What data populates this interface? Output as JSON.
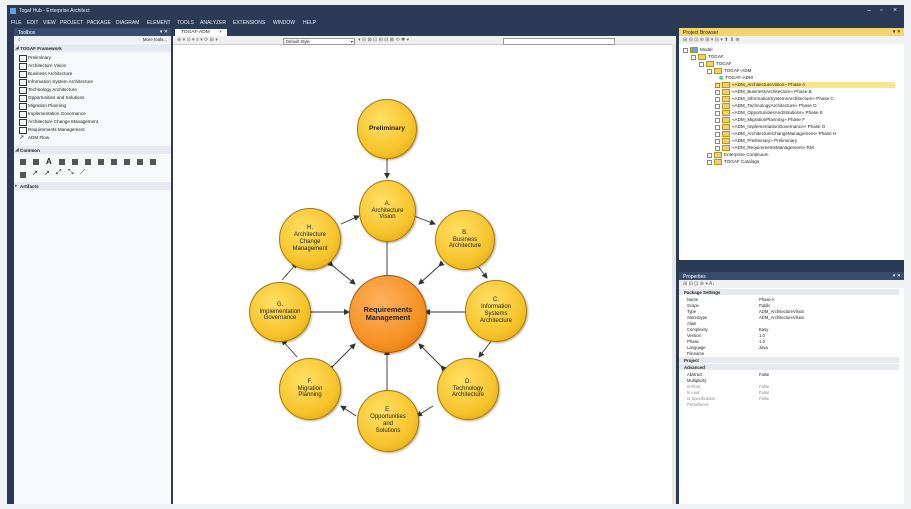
{
  "window": {
    "title": "Togaf Hub - Enterprise Architect"
  },
  "menu": [
    "FILE",
    "EDIT",
    "VIEW",
    "PROJECT",
    "PACKAGE",
    "DIAGRAM",
    "ELEMENT",
    "TOOLS",
    "ANALYZER",
    "EXTENSIONS",
    "WINDOW",
    "HELP"
  ],
  "toolbox": {
    "title": "Toolbox",
    "more_tools": "More tools...",
    "section_togaf": "TOGAF Framework",
    "items": [
      "Preliminary",
      "Architecture Vision",
      "Business Architecture",
      "Information System Architecture",
      "Technology Architecture",
      "Opportunities and Solutions",
      "Migration Planning",
      "Implementation Governance",
      "Architecture Change Management",
      "Requirements Management",
      "ADM Flow"
    ],
    "section_common": "Common",
    "section_artifacts": "Artifacts"
  },
  "diagram": {
    "tab": "TOGAF-ADM",
    "style": "Default Style",
    "nodes": {
      "prelim": "Preliminary",
      "a": "A.\nArchitecture\nVision",
      "b": "B.\nBusiness\nArchitecture",
      "c": "C.\nInformation\nSystems\nArchitecture",
      "d": "D.\nTechnology\nArchitecture",
      "e": "E.\nOpportunities\nand\nSolutions",
      "f": "F.\nMigration\nPlanning",
      "g": "G.\nImplementation\nGovernance",
      "h": "H.\nArchitecture\nChange\nManagement",
      "center": "Requirements\nManagement"
    }
  },
  "browser": {
    "title": "Project Browser",
    "model": "Model",
    "togaf": "TOGAF",
    "togaf2": "TOGAF",
    "adm": "TOGAF-ADM",
    "adm_diagram": "TOGAF-ADM",
    "phases": [
      "«ADM_ArchitectureVision» Phase A",
      "«ADM_BusinessArchitecture» Phase B",
      "«ADM_InformationSystemsArchitecture» Phase C",
      "«ADM_TechnologyArchitecture» Phase D",
      "«ADM_OpportunitiesAndSolutions» Phase E",
      "«ADM_MigrationPlanning» Phase F",
      "«ADM_ImplementationGovernance» Phase G",
      "«ADM_ArchitectureChangeManagement» Phase H",
      "«ADM_Preliminary» Preliminary",
      "«ADM_RequirementsManagement» RM"
    ],
    "continuum": "Enterprise Continuum",
    "catalogs": "TOGAF Catalogs"
  },
  "properties": {
    "title": "Properties",
    "section_package": "Package Settings",
    "rows": [
      {
        "k": "Name",
        "v": "Phase A"
      },
      {
        "k": "Scope",
        "v": "Public"
      },
      {
        "k": "Type",
        "v": "ADM_ArchitectureVision"
      },
      {
        "k": "Stereotype",
        "v": "ADM_ArchitectureVision"
      },
      {
        "k": "Alias",
        "v": ""
      },
      {
        "k": "Complexity",
        "v": "Easy"
      },
      {
        "k": "Version",
        "v": "1.0"
      },
      {
        "k": "Phase",
        "v": "1.0"
      },
      {
        "k": "Language",
        "v": "Java"
      },
      {
        "k": "Filename",
        "v": ""
      }
    ],
    "section_project": "Project",
    "section_advanced": "Advanced",
    "adv_rows": [
      {
        "k": "Abstract",
        "v": "False"
      },
      {
        "k": "Multiplicity",
        "v": ""
      },
      {
        "k": "Is Root",
        "v": "False"
      },
      {
        "k": "Is Leaf",
        "v": "False"
      },
      {
        "k": "Is Specification",
        "v": "False"
      },
      {
        "k": "Persistence",
        "v": ""
      }
    ]
  }
}
